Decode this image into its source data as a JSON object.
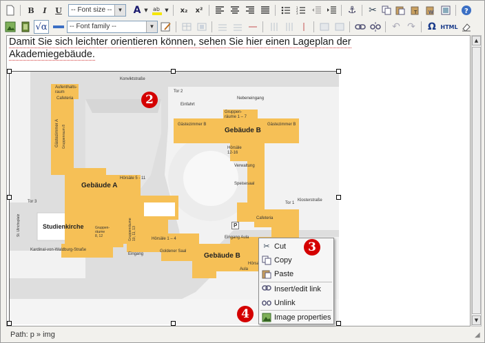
{
  "toolbar": {
    "font_size_label": "-- Font size --",
    "font_family_label": "-- Font family --",
    "bold": "B",
    "italic": "I",
    "underline": "U",
    "subscript": "x₂",
    "superscript": "x²",
    "omega": "Ω",
    "html": "HTML"
  },
  "content": {
    "paragraph": "Damit Sie sich leichter orientieren können, sehen Sie hier einen Lageplan der Akademiegebäude."
  },
  "statusbar": {
    "path_label": "Path:",
    "path_value": "p » img"
  },
  "map": {
    "streets": {
      "konvikt": "Konviktstraße",
      "kardinal": "Kardinal-von-Waldburg-Straße",
      "kloster": "Klosterstraße",
      "ulrich": "St. Ulrichsplatz"
    },
    "labels": {
      "tor2": "Tor 2",
      "tor3": "Tor 3",
      "tor1": "Tor 1",
      "einfahrt": "Einfahrt",
      "nebeneingang": "Nebeneingang",
      "gruppenraeume_1_7": "Gruppen-\nräume 1 – 7",
      "gaestezimmer_b_left": "Gästezimmer B",
      "gaestezimmer_b_right": "Gästezimmer B",
      "gebaeude_b_top": "Gebäude B",
      "aufenthaltsraum": "Aufenthalts-\nraum",
      "cafeteria_a": "Cafeteria",
      "gaestezimmer_a": "Gästezimmer A",
      "gruppenraum_8": "Gruppenraum 8",
      "gebaeude_a": "Gebäude A",
      "hoersaele_5_11": "Hörsäle 5 - 11",
      "hoersaele_12_16": "Hörsäle\n12-16",
      "verwaltung": "Verwaltung",
      "speisesaal": "Speisesaal",
      "studienkirche": "Studienkirche",
      "gruppenraume_8_12": "Gruppen-\nräume\n8, 12",
      "gruppenraume_9_13": "Gruppenräume\n10, 11, 13",
      "hoersaele_1_4": "Hörsäle 1 – 4",
      "goldener_saal": "Goldener Saal",
      "eingang": "Eingang",
      "eingang_aula": "Eingang Aula",
      "gebaeude_b_bottom": "Gebäude B",
      "cafeteria_b": "Cafeteria",
      "hoersaal_17": "Hörsaal 17",
      "aula": "Aula",
      "parking": "P"
    }
  },
  "context_menu": {
    "items": [
      {
        "label": "Cut",
        "icon": "scissors-icon"
      },
      {
        "label": "Copy",
        "icon": "copy-icon"
      },
      {
        "label": "Paste",
        "icon": "paste-icon"
      },
      {
        "label": "Insert/edit link",
        "icon": "link-icon"
      },
      {
        "label": "Unlink",
        "icon": "unlink-icon"
      },
      {
        "label": "Image properties",
        "icon": "image-icon"
      }
    ]
  },
  "badges": {
    "two": "2",
    "three": "3",
    "four": "4"
  },
  "colors": {
    "building": "#f6c056",
    "building_dark": "#e8a93a",
    "badge": "#d40000",
    "road": "#dedede"
  }
}
